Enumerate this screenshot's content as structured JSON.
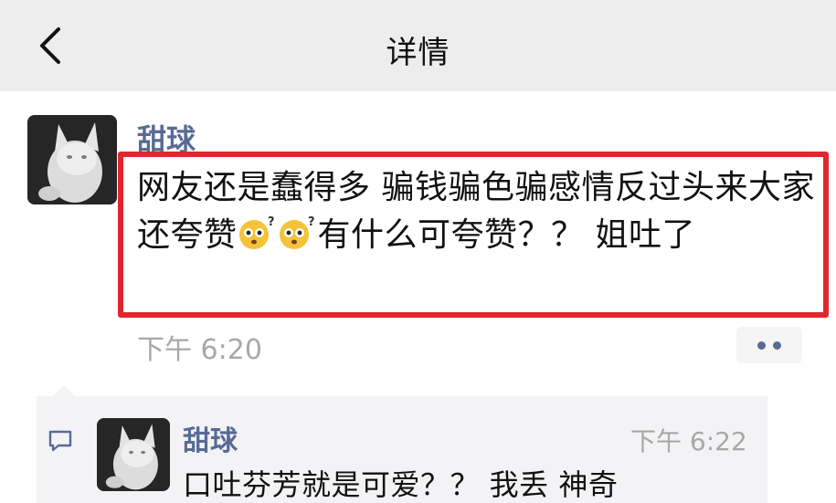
{
  "navbar": {
    "title": "详情",
    "back_icon": "chevron-left-icon"
  },
  "post": {
    "author": "甜球",
    "avatar_icon": "white-cat-avatar",
    "text_before_emoji": "网友还是蠢得多 骗钱骗色骗感情反过头来大家还夸赞",
    "emoji_icon": "confused-face-emoji",
    "emoji_count": 2,
    "text_after_emoji": "有什么可夸赞？？ 姐吐了",
    "time": "下午 6:20",
    "more_icon": "more-dots-icon"
  },
  "comments": [
    {
      "author": "甜球",
      "avatar_icon": "white-cat-avatar",
      "time": "下午 6:22",
      "text": "口吐芬芳就是可爱？？ 我丢 神奇"
    }
  ],
  "comment_section_icon": "comment-bubble-icon",
  "colors": {
    "navbar_bg": "#ededed",
    "name_blue": "#576b95",
    "highlight_red": "#e0262e",
    "time_gray": "#a8a8a8",
    "comment_bg": "#f3f3f5"
  }
}
